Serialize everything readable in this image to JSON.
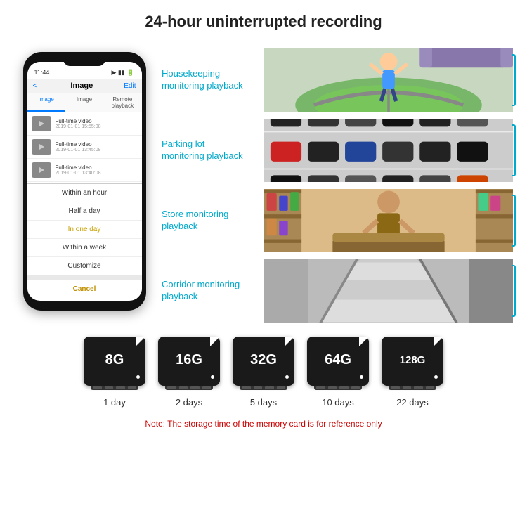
{
  "header": {
    "title": "24-hour uninterrupted recording"
  },
  "phone": {
    "status_time": "11:44",
    "nav_title": "Image",
    "nav_back": "<",
    "nav_edit": "Edit",
    "tabs": [
      "Image",
      "Image",
      "Remote playback"
    ],
    "list_items": [
      {
        "title": "Full-time video",
        "sub": "2019-01-01 15:55:08"
      },
      {
        "title": "Full-time video",
        "sub": "2019-01-01 13:45:08"
      },
      {
        "title": "Full-time video",
        "sub": "2019-01-01 13:40:08"
      }
    ],
    "dropdown_items": [
      "Within an hour",
      "Half a day",
      "In one day",
      "Within a week",
      "Customize"
    ],
    "cancel_label": "Cancel"
  },
  "monitoring": [
    {
      "label": "Housekeeping\nmonitoring playback",
      "scene": "child"
    },
    {
      "label": "Parking lot\nmonitoring playback",
      "scene": "parking"
    },
    {
      "label": "Store monitoring\nplayback",
      "scene": "store"
    },
    {
      "label": "Corridor monitoring\nplayback",
      "scene": "corridor"
    }
  ],
  "storage": {
    "cards": [
      {
        "size": "8G",
        "days": "1 day"
      },
      {
        "size": "16G",
        "days": "2 days"
      },
      {
        "size": "32G",
        "days": "5 days"
      },
      {
        "size": "64G",
        "days": "10 days"
      },
      {
        "size": "128G",
        "days": "22 days"
      }
    ],
    "note": "Note: The storage time of the memory card is for reference only"
  }
}
